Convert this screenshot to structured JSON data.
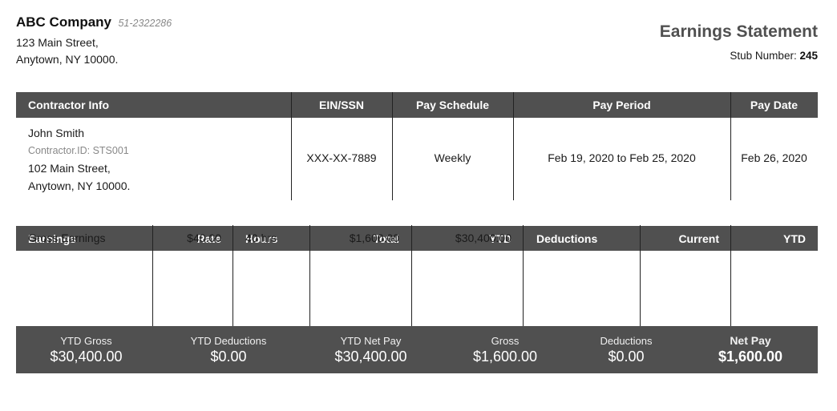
{
  "company": {
    "name": "ABC Company",
    "ein": "51-2322286",
    "address_line1": "123 Main Street,",
    "address_line2": "Anytown, NY 10000."
  },
  "statement": {
    "title": "Earnings Statement",
    "stub_label": "Stub Number:",
    "stub_number": "245"
  },
  "info_table": {
    "headers": [
      "Contractor Info",
      "EIN/SSN",
      "Pay Schedule",
      "Pay Period",
      "Pay Date"
    ],
    "contractor": {
      "name": "John Smith",
      "id_line": "Contractor.ID: STS001",
      "address_line1": "102 Main Street,",
      "address_line2": "Anytown, NY 10000."
    },
    "ein_ssn": "XXX-XX-7889",
    "pay_schedule": "Weekly",
    "pay_period": "Feb 19, 2020 to Feb 25, 2020",
    "pay_date": "Feb 26, 2020"
  },
  "earnings_table": {
    "headers": [
      "Earnings",
      "Rate",
      "Hours",
      "Total",
      "YTD",
      "Deductions",
      "Current",
      "YTD"
    ],
    "rows": [
      {
        "earnings": "Gross Earnings",
        "rate": "$40.00",
        "hours": "40 hrs",
        "total": "$1,600.00",
        "ytd": "$30,400.00",
        "deductions": "",
        "current": "",
        "deductions_ytd": ""
      }
    ]
  },
  "summary": [
    {
      "label": "YTD Gross",
      "value": "$30,400.00"
    },
    {
      "label": "YTD Deductions",
      "value": "$0.00"
    },
    {
      "label": "YTD Net Pay",
      "value": "$30,400.00"
    },
    {
      "label": "Gross",
      "value": "$1,600.00"
    },
    {
      "label": "Deductions",
      "value": "$0.00"
    },
    {
      "label": "Net Pay",
      "value": "$1,600.00"
    }
  ],
  "colors": {
    "header_bg": "#505050",
    "header_text": "#ffffff",
    "title_text": "#505050"
  }
}
